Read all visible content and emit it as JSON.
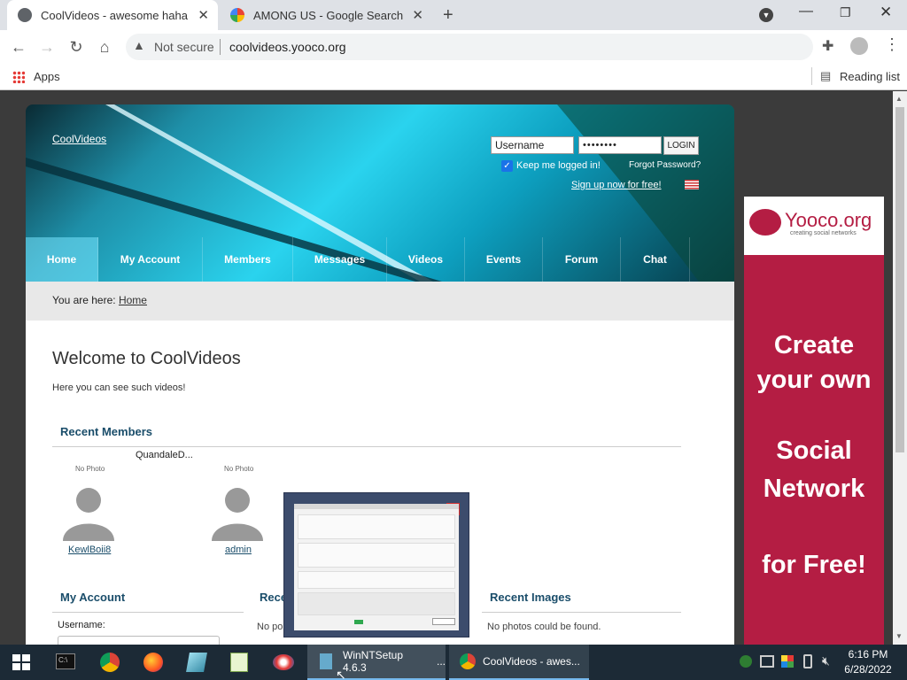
{
  "browser": {
    "tabs": [
      {
        "title": "CoolVideos - awesome haha"
      },
      {
        "title": "AMONG US - Google Search"
      }
    ],
    "not_secure": "Not secure",
    "url": "coolvideos.yooco.org",
    "apps": "Apps",
    "reading_list": "Reading list"
  },
  "site": {
    "logo_alt": "CoolVideos",
    "username_placeholder": "Username",
    "password_value": "••••••••",
    "login": "LOGIN",
    "keep_logged": "Keep me logged in!",
    "forgot": "Forgot Password?",
    "signup": "Sign up now for free!",
    "nav": [
      "Home",
      "My Account",
      "Members",
      "Messages",
      "Videos",
      "Events",
      "Forum",
      "Chat"
    ],
    "breadcrumb_prefix": "You are here:",
    "breadcrumb_link": "Home",
    "welcome": "Welcome to CoolVideos",
    "subtitle": "Here you can see such videos!",
    "recent_members": "Recent Members",
    "members": [
      {
        "name": "KewlBoii8",
        "photo": "No Photo"
      },
      {
        "name": "admin",
        "photo": "No Photo"
      },
      {
        "name": "QuandaleD...",
        "photo": ""
      }
    ],
    "my_account": "My Account",
    "username_label": "Username:",
    "recent_partial": "Rece",
    "no_posts_partial": "No po",
    "recent_images": "Recent Images",
    "no_photos": "No photos could be found."
  },
  "ad": {
    "brand": "Yooco.org",
    "tagline": "creating social networks",
    "line1": "Create",
    "line2": "your own",
    "line3": "Social",
    "line4": "Network",
    "line5": "for Free!"
  },
  "taskbar": {
    "winnt": "WinNTSetup 4.6.3",
    "winnt_more": "...",
    "chrome": "CoolVideos - awes...",
    "time": "6:16 PM",
    "date": "6/28/2022"
  }
}
